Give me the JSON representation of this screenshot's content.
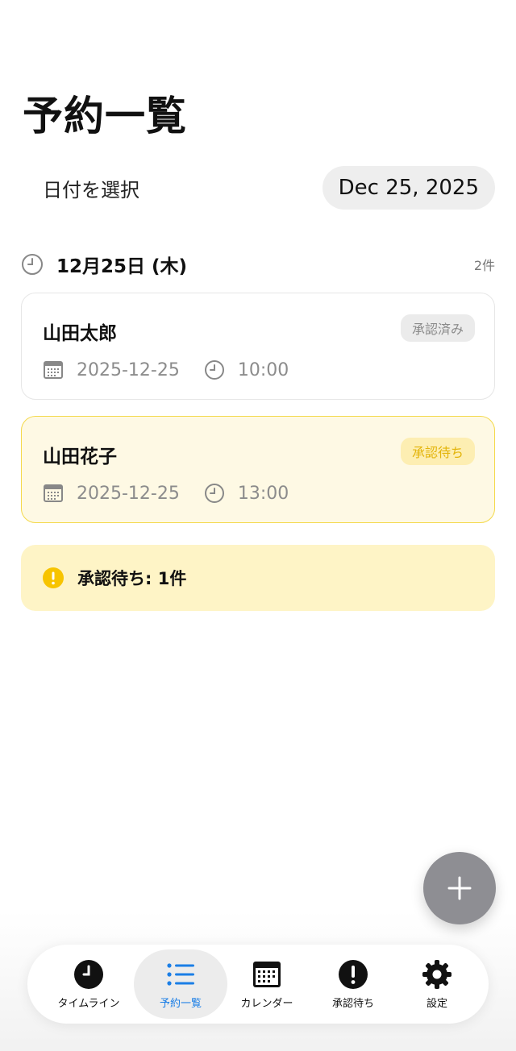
{
  "page": {
    "title": "予約一覧"
  },
  "date_picker": {
    "label": "日付を選択",
    "value": "Dec 25, 2025"
  },
  "section": {
    "title": "12月25日 (木)",
    "count": "2件"
  },
  "reservations": [
    {
      "name": "山田太郎",
      "status": "承認済み",
      "date": "2025-12-25",
      "time": "10:00"
    },
    {
      "name": "山田花子",
      "status": "承認待ち",
      "date": "2025-12-25",
      "time": "13:00"
    }
  ],
  "notice": {
    "text": "承認待ち: 1件"
  },
  "tabs": [
    {
      "label": "タイムライン",
      "icon": "clock-icon",
      "active": false
    },
    {
      "label": "予約一覧",
      "icon": "list-icon",
      "active": true
    },
    {
      "label": "カレンダー",
      "icon": "calendar-icon",
      "active": false
    },
    {
      "label": "承認待ち",
      "icon": "exclamation-icon",
      "active": false
    },
    {
      "label": "設定",
      "icon": "gear-icon",
      "active": false
    }
  ],
  "colors": {
    "accent": "#1a7ee6",
    "pending_border": "#f4d94b",
    "pending_badge_text": "#e3b40a",
    "fab": "#8e8e93"
  }
}
